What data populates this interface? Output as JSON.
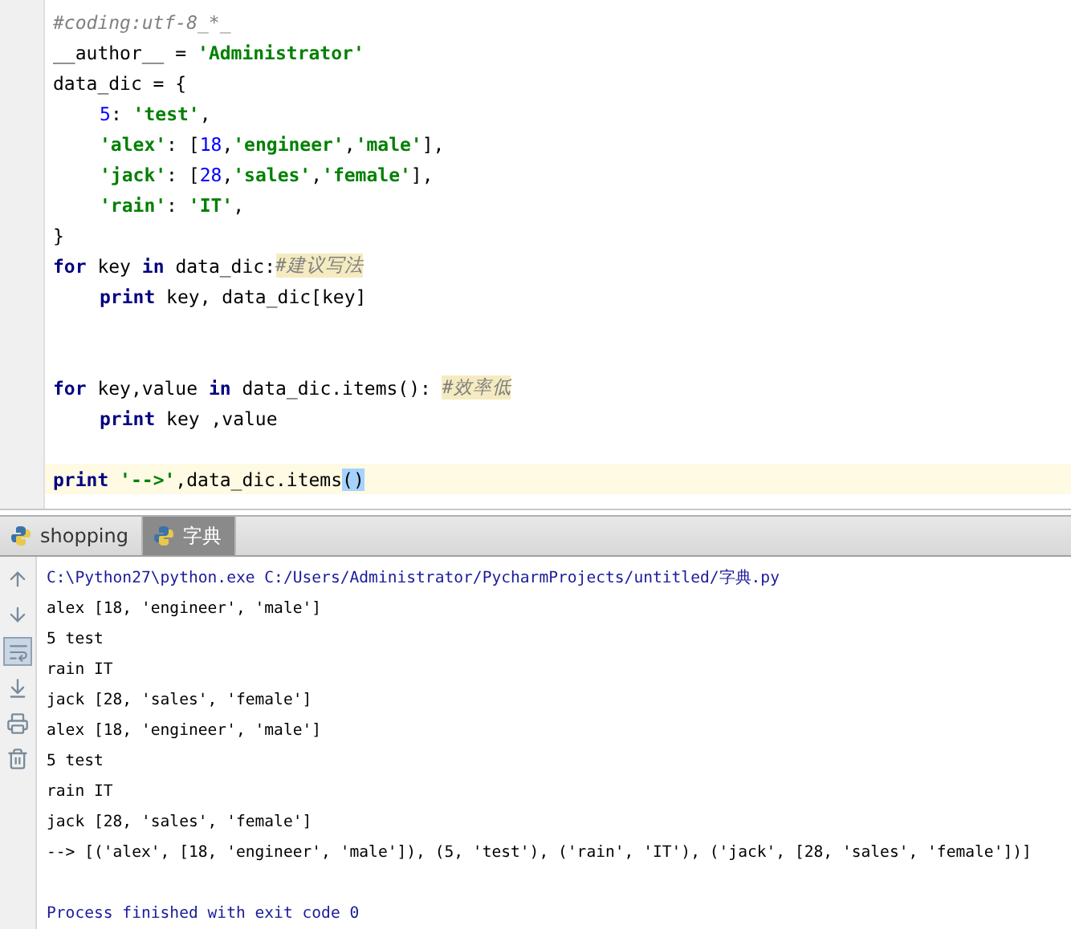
{
  "editor": {
    "lines": [
      {
        "indented": false,
        "current": false,
        "tokens": [
          {
            "kind": "comment",
            "text": "#coding:utf-8_*_"
          }
        ]
      },
      {
        "indented": false,
        "current": false,
        "tokens": [
          {
            "kind": "plain",
            "text": "__author__ = "
          },
          {
            "kind": "string",
            "text": "'Administrator'"
          }
        ]
      },
      {
        "indented": false,
        "current": false,
        "tokens": [
          {
            "kind": "plain",
            "text": "data_dic = {"
          }
        ]
      },
      {
        "indented": true,
        "current": false,
        "tokens": [
          {
            "kind": "number",
            "text": "5"
          },
          {
            "kind": "plain",
            "text": ": "
          },
          {
            "kind": "string",
            "text": "'test'"
          },
          {
            "kind": "plain",
            "text": ","
          }
        ]
      },
      {
        "indented": true,
        "current": false,
        "tokens": [
          {
            "kind": "string",
            "text": "'alex'"
          },
          {
            "kind": "plain",
            "text": ": ["
          },
          {
            "kind": "number",
            "text": "18"
          },
          {
            "kind": "plain",
            "text": ","
          },
          {
            "kind": "string",
            "text": "'engineer'"
          },
          {
            "kind": "plain",
            "text": ","
          },
          {
            "kind": "string",
            "text": "'male'"
          },
          {
            "kind": "plain",
            "text": "],"
          }
        ]
      },
      {
        "indented": true,
        "current": false,
        "tokens": [
          {
            "kind": "string",
            "text": "'jack'"
          },
          {
            "kind": "plain",
            "text": ": ["
          },
          {
            "kind": "number",
            "text": "28"
          },
          {
            "kind": "plain",
            "text": ","
          },
          {
            "kind": "string",
            "text": "'sales'"
          },
          {
            "kind": "plain",
            "text": ","
          },
          {
            "kind": "string",
            "text": "'female'"
          },
          {
            "kind": "plain",
            "text": "],"
          }
        ]
      },
      {
        "indented": true,
        "current": false,
        "tokens": [
          {
            "kind": "string",
            "text": "'rain'"
          },
          {
            "kind": "plain",
            "text": ": "
          },
          {
            "kind": "string",
            "text": "'IT'"
          },
          {
            "kind": "plain",
            "text": ","
          }
        ]
      },
      {
        "indented": false,
        "current": false,
        "tokens": [
          {
            "kind": "plain",
            "text": "}"
          }
        ]
      },
      {
        "indented": false,
        "current": false,
        "tokens": [
          {
            "kind": "keyword",
            "text": "for"
          },
          {
            "kind": "plain",
            "text": " key "
          },
          {
            "kind": "keyword",
            "text": "in"
          },
          {
            "kind": "plain",
            "text": " data_dic:"
          },
          {
            "kind": "marked_comment",
            "text": "#建议写法"
          }
        ]
      },
      {
        "indented": true,
        "current": false,
        "tokens": [
          {
            "kind": "keyword",
            "text": "print"
          },
          {
            "kind": "plain",
            "text": " key, data_dic[key]"
          }
        ]
      },
      {
        "current": false
      },
      {
        "current": false
      },
      {
        "indented": false,
        "current": false,
        "tokens": [
          {
            "kind": "keyword",
            "text": "for"
          },
          {
            "kind": "plain",
            "text": " key,value "
          },
          {
            "kind": "keyword",
            "text": "in"
          },
          {
            "kind": "plain",
            "text": " data_dic.items(): "
          },
          {
            "kind": "marked_comment",
            "text": "#效率低"
          }
        ]
      },
      {
        "indented": true,
        "current": false,
        "tokens": [
          {
            "kind": "keyword",
            "text": "print"
          },
          {
            "kind": "plain",
            "text": " key ,value"
          }
        ]
      },
      {
        "current": false
      },
      {
        "indented": false,
        "current": true,
        "tokens": [
          {
            "kind": "keyword",
            "text": "print "
          },
          {
            "kind": "string",
            "text": "'-->'"
          },
          {
            "kind": "plain",
            "text": ",data_dic.items"
          },
          {
            "kind": "selection",
            "text": "()"
          }
        ]
      }
    ]
  },
  "run_tabs": [
    {
      "label": "shopping",
      "selected": false
    },
    {
      "label": "字典",
      "selected": true
    }
  ],
  "output": {
    "lines": [
      {
        "kind": "command",
        "text": "C:\\Python27\\python.exe C:/Users/Administrator/PycharmProjects/untitled/字典.py"
      },
      {
        "kind": "stdout",
        "text": "alex [18, 'engineer', 'male']"
      },
      {
        "kind": "stdout",
        "text": "5 test"
      },
      {
        "kind": "stdout",
        "text": "rain IT"
      },
      {
        "kind": "stdout",
        "text": "jack [28, 'sales', 'female']"
      },
      {
        "kind": "stdout",
        "text": "alex [18, 'engineer', 'male']"
      },
      {
        "kind": "stdout",
        "text": "5 test"
      },
      {
        "kind": "stdout",
        "text": "rain IT"
      },
      {
        "kind": "stdout",
        "text": "jack [28, 'sales', 'female']"
      },
      {
        "kind": "stdout",
        "text": "--> [('alex', [18, 'engineer', 'male']), (5, 'test'), ('rain', 'IT'), ('jack', [28, 'sales', 'female'])]"
      },
      {
        "kind": "blank"
      },
      {
        "kind": "system",
        "text": "Process finished with exit code 0"
      }
    ]
  }
}
